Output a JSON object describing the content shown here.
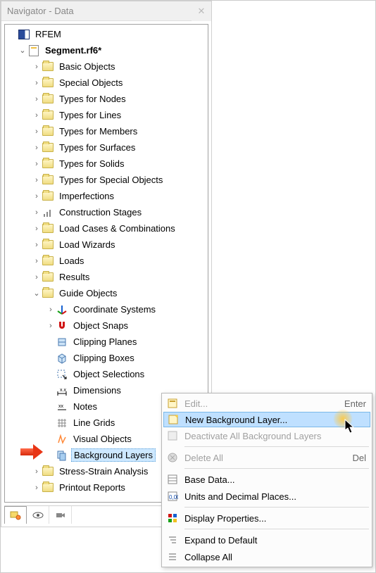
{
  "window_title": "Navigator - Data",
  "root_app": "RFEM",
  "file_name": "Segment.rf6*",
  "tree": [
    {
      "label": "Basic Objects",
      "icon": "folder"
    },
    {
      "label": "Special Objects",
      "icon": "folder"
    },
    {
      "label": "Types for Nodes",
      "icon": "folder"
    },
    {
      "label": "Types for Lines",
      "icon": "folder"
    },
    {
      "label": "Types for Members",
      "icon": "folder"
    },
    {
      "label": "Types for Surfaces",
      "icon": "folder"
    },
    {
      "label": "Types for Solids",
      "icon": "folder"
    },
    {
      "label": "Types for Special Objects",
      "icon": "folder"
    },
    {
      "label": "Imperfections",
      "icon": "folder"
    },
    {
      "label": "Construction Stages",
      "icon": "stages"
    },
    {
      "label": "Load Cases & Combinations",
      "icon": "folder"
    },
    {
      "label": "Load Wizards",
      "icon": "folder"
    },
    {
      "label": "Loads",
      "icon": "folder"
    },
    {
      "label": "Results",
      "icon": "folder"
    }
  ],
  "guide_objects_label": "Guide Objects",
  "guide_children": [
    {
      "label": "Coordinate Systems",
      "icon": "axes",
      "twisty": true
    },
    {
      "label": "Object Snaps",
      "icon": "magnet",
      "twisty": true
    },
    {
      "label": "Clipping Planes",
      "icon": "plane",
      "twisty": false
    },
    {
      "label": "Clipping Boxes",
      "icon": "box",
      "twisty": false
    },
    {
      "label": "Object Selections",
      "icon": "select",
      "twisty": false
    },
    {
      "label": "Dimensions",
      "icon": "dim",
      "twisty": false
    },
    {
      "label": "Notes",
      "icon": "notes",
      "twisty": false
    },
    {
      "label": "Line Grids",
      "icon": "grid",
      "twisty": false
    },
    {
      "label": "Visual Objects",
      "icon": "visual",
      "twisty": false
    },
    {
      "label": "Background Layers",
      "icon": "layers",
      "twisty": false,
      "selected": true
    }
  ],
  "after_guide": [
    {
      "label": "Stress-Strain Analysis",
      "icon": "folder"
    },
    {
      "label": "Printout Reports",
      "icon": "folder"
    }
  ],
  "context_menu": [
    {
      "label": "Edit...",
      "shortcut": "Enter",
      "disabled": true,
      "icon": "edit"
    },
    {
      "label": "New Background Layer...",
      "highlight": true,
      "icon": "new"
    },
    {
      "label": "Deactivate All Background Layers",
      "disabled": true,
      "icon": "deactivate"
    },
    {
      "sep": true
    },
    {
      "label": "Delete All",
      "shortcut": "Del",
      "disabled": true,
      "icon": "delete"
    },
    {
      "sep": true
    },
    {
      "label": "Base Data...",
      "icon": "basedata"
    },
    {
      "label": "Units and Decimal Places...",
      "icon": "units"
    },
    {
      "sep": true
    },
    {
      "label": "Display Properties...",
      "icon": "display"
    },
    {
      "sep": true
    },
    {
      "label": "Expand to Default",
      "icon": "expand"
    },
    {
      "label": "Collapse All",
      "icon": "collapse"
    }
  ]
}
